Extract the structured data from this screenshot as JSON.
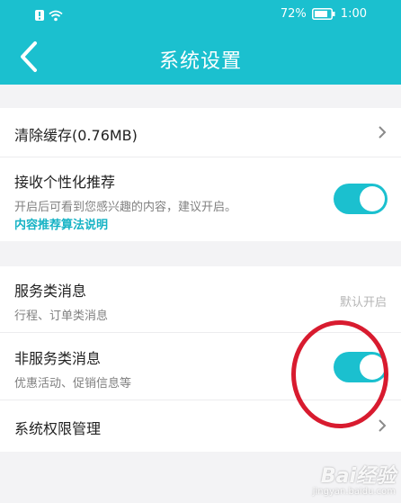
{
  "status_bar": {
    "battery_percent": "72%",
    "time": "1:00"
  },
  "header": {
    "title": "系统设置"
  },
  "group1": {
    "clear_cache": {
      "label": "清除缓存(0.76MB)"
    },
    "personal_recommend": {
      "label": "接收个性化推荐",
      "description": "开启后可看到您感兴趣的内容，建议开启。",
      "link": "内容推荐算法说明",
      "enabled": true
    }
  },
  "group2": {
    "service_messages": {
      "label": "服务类消息",
      "description": "行程、订单类消息",
      "hint": "默认开启"
    },
    "non_service_messages": {
      "label": "非服务类消息",
      "description": "优惠活动、促销信息等",
      "enabled": true
    },
    "permissions": {
      "label": "系统权限管理"
    }
  },
  "watermark": {
    "brand": "Bai经验",
    "url": "jingyan.baidu.com"
  },
  "colors": {
    "accent": "#1bc0cf",
    "annotation": "#d81b2f"
  }
}
